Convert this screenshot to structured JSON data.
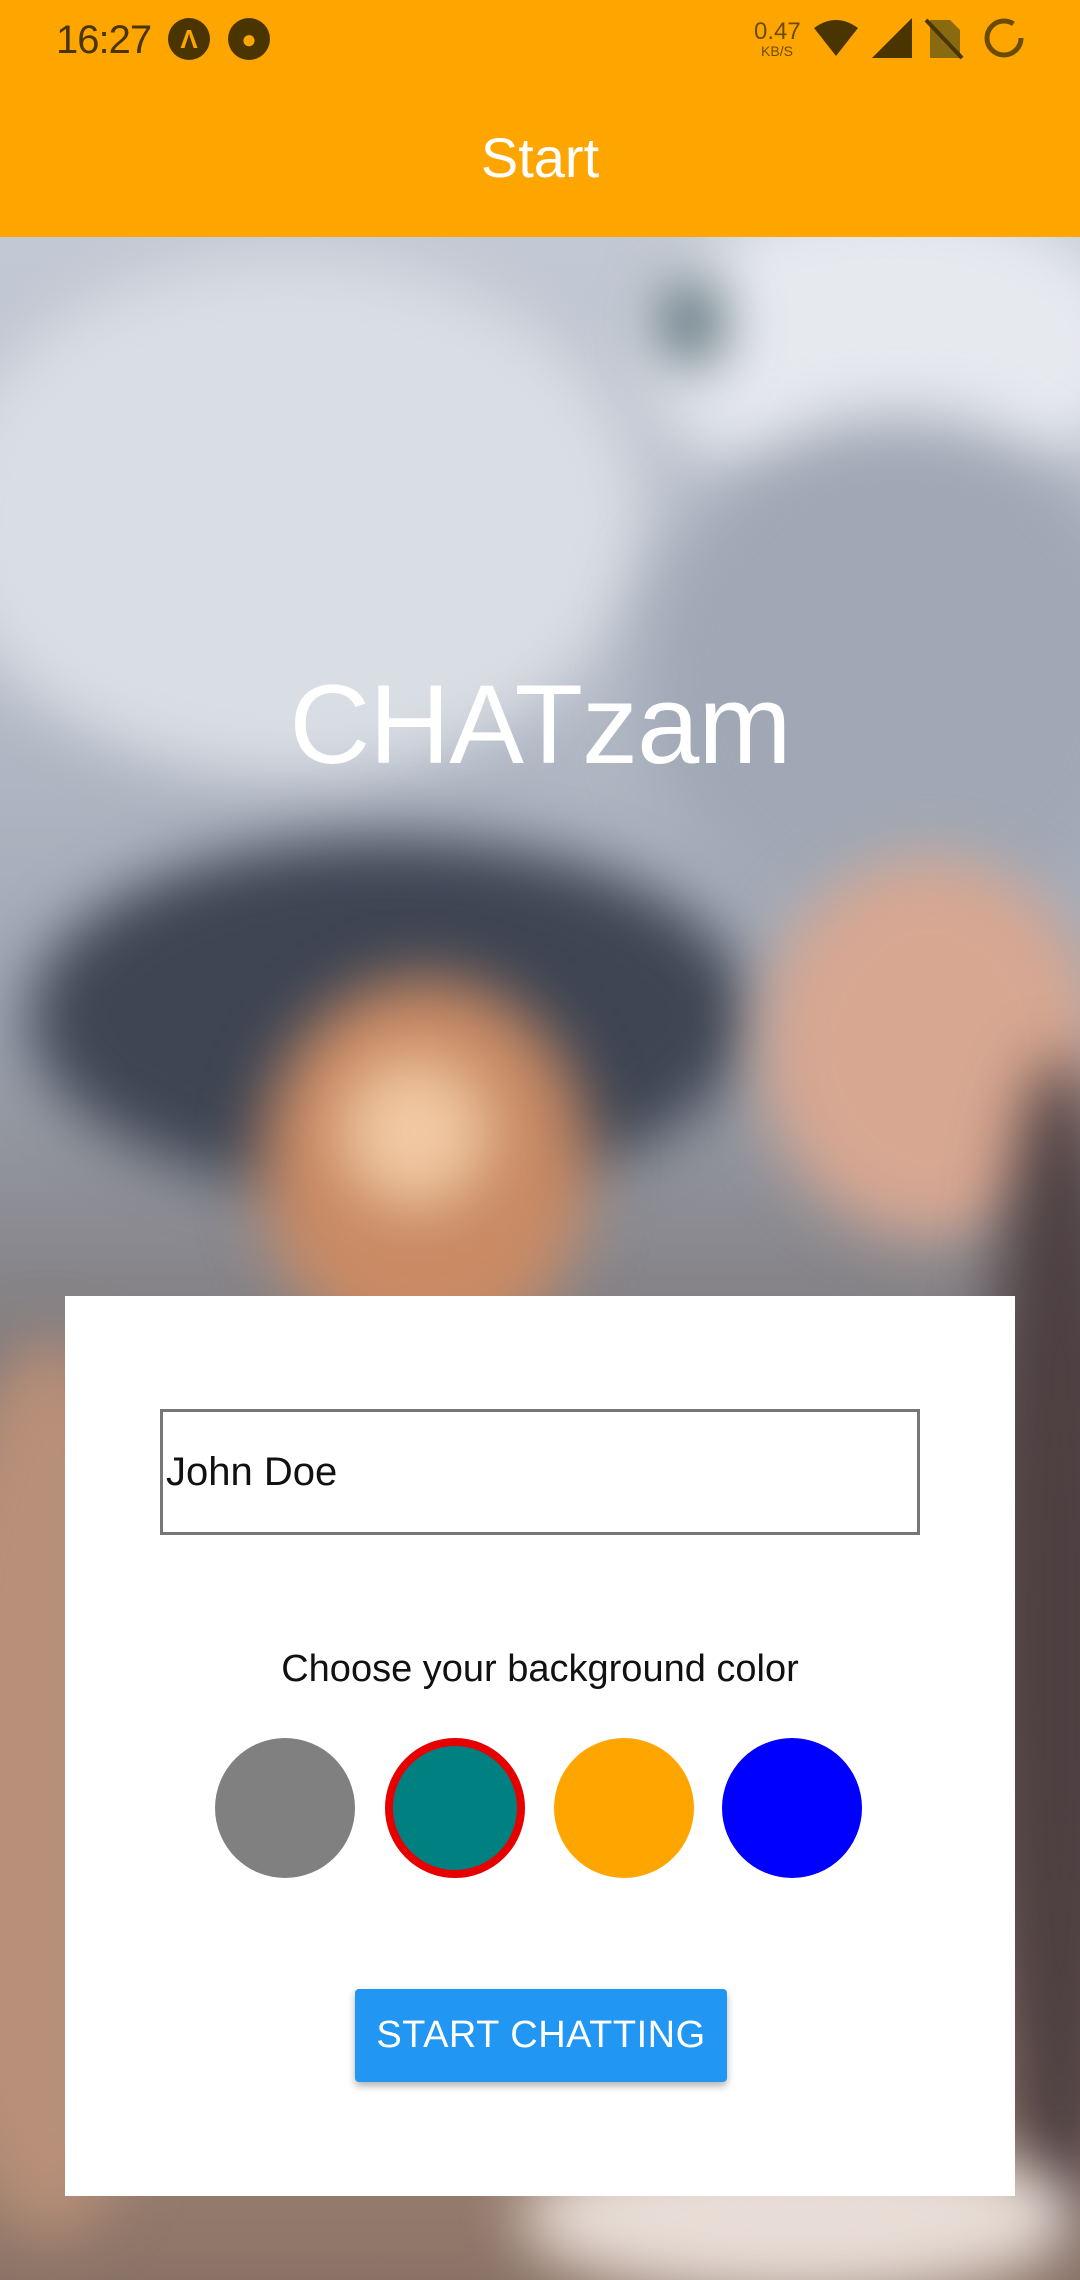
{
  "status_bar": {
    "time": "16:27",
    "speed_value": "0.47",
    "speed_unit": "KB/S",
    "icons": [
      "app-a-icon",
      "app-b-icon",
      "wifi-icon",
      "cell-signal-icon",
      "no-sim-icon",
      "battery-icon"
    ]
  },
  "app_bar": {
    "title": "Start",
    "color": "#FFA500"
  },
  "brand": {
    "title": "CHATzam"
  },
  "form": {
    "name_value": "John Doe",
    "color_prompt": "Choose your background color",
    "colors": [
      "#808080",
      "#008080",
      "#FFA500",
      "#0000FF"
    ],
    "selected_color_index": 1,
    "selected_border_color": "#E60000",
    "start_button_label": "START CHATTING",
    "start_button_color": "#2196F3"
  }
}
